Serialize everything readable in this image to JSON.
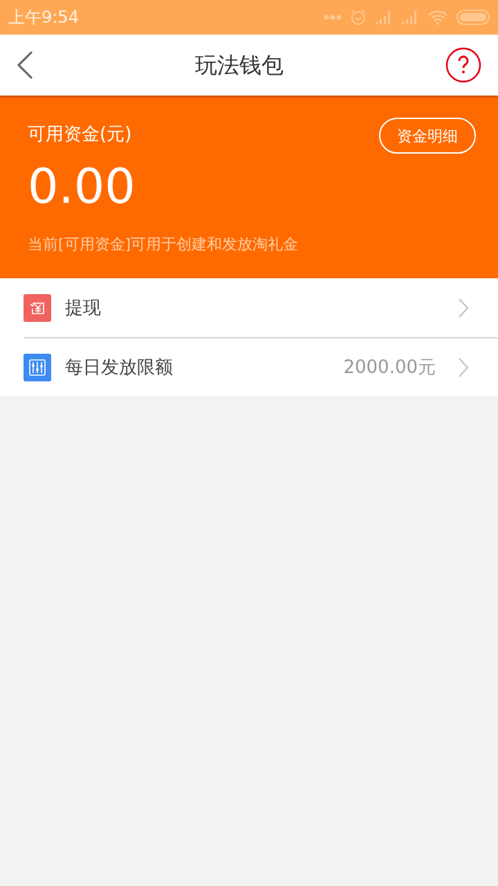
{
  "status_bar": {
    "time": "上午9:54"
  },
  "header": {
    "title": "玩法钱包"
  },
  "balance": {
    "label": "可用资金(元)",
    "amount": "0.00",
    "details_button": "资金明细",
    "note": "当前[可用资金]可用于创建和发放淘礼金"
  },
  "menu": [
    {
      "kind": "withdraw",
      "label": "提现"
    },
    {
      "kind": "limit",
      "label": "每日发放限额",
      "value": "2000.00元"
    }
  ]
}
